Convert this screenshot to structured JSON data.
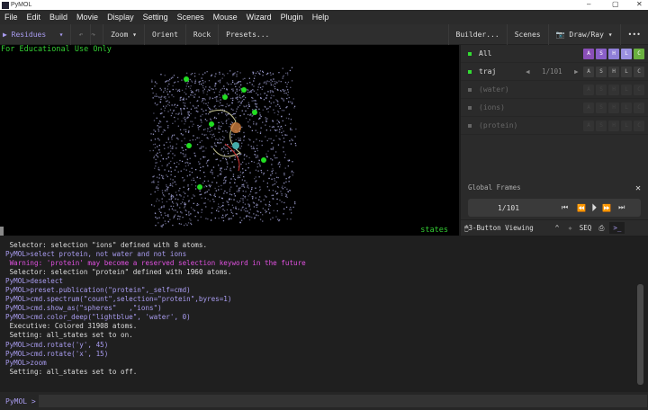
{
  "window": {
    "title": "PyMOL",
    "minimize": "–",
    "maximize": "▢",
    "close": "✕"
  },
  "menu": [
    "File",
    "Edit",
    "Build",
    "Movie",
    "Display",
    "Setting",
    "Scenes",
    "Mouse",
    "Wizard",
    "Plugin",
    "Help"
  ],
  "toolbar": {
    "mode": "Residues",
    "zoom": "Zoom",
    "orient": "Orient",
    "rock": "Rock",
    "presets": "Presets...",
    "builder": "Builder...",
    "scenes": "Scenes",
    "drawray": "Draw/Ray",
    "more": "•••"
  },
  "viewport": {
    "watermark": "For Educational Use Only",
    "states": "states"
  },
  "objects": [
    {
      "name": "All",
      "buttons": [
        "A",
        "S",
        "H",
        "L",
        "C"
      ],
      "enabled": true
    },
    {
      "name": "traj",
      "frame": "1/101",
      "buttons": [
        "A",
        "S",
        "H",
        "L",
        "C"
      ],
      "enabled": true
    },
    {
      "name": "(water)",
      "buttons": [
        "A",
        "S",
        "H",
        "L",
        "C"
      ],
      "enabled": false
    },
    {
      "name": "(ions)",
      "buttons": [
        "A",
        "S",
        "H",
        "L",
        "C"
      ],
      "enabled": false
    },
    {
      "name": "(protein)",
      "buttons": [
        "A",
        "S",
        "H",
        "L",
        "C"
      ],
      "enabled": false
    }
  ],
  "global_frames": {
    "label": "Global Frames",
    "frame": "1/101"
  },
  "statusbar": {
    "mouse_mode": "3-Button Viewing",
    "seq": "SEQ"
  },
  "console": [
    {
      "t": " Selector: selection \"ions\" defined with 8 atoms.",
      "c": "#ddd"
    },
    {
      "t": "PyMOL>select protein, not water and not ions",
      "c": "#a99cf0"
    },
    {
      "t": " Warning: 'protein' may become a reserved selection keyword in the future",
      "c": "#e050e0"
    },
    {
      "t": " Selector: selection \"protein\" defined with 1960 atoms.",
      "c": "#ddd"
    },
    {
      "t": "PyMOL>deselect",
      "c": "#a99cf0"
    },
    {
      "t": "PyMOL>preset.publication(\"protein\",_self=cmd)",
      "c": "#a99cf0"
    },
    {
      "t": "PyMOL>cmd.spectrum(\"count\",selection=\"protein\",byres=1)",
      "c": "#a99cf0"
    },
    {
      "t": "PyMOL>cmd.show_as(\"spheres\"   ,\"ions\")",
      "c": "#a99cf0"
    },
    {
      "t": "PyMOL>cmd.color_deep(\"lightblue\", 'water', 0)",
      "c": "#a99cf0"
    },
    {
      "t": " Executive: Colored 31908 atoms.",
      "c": "#ddd"
    },
    {
      "t": " Setting: all_states set to on.",
      "c": "#ddd"
    },
    {
      "t": "PyMOL>cmd.rotate('y', 45)",
      "c": "#a99cf0"
    },
    {
      "t": "PyMOL>cmd.rotate('x', 15)",
      "c": "#a99cf0"
    },
    {
      "t": "PyMOL>zoom",
      "c": "#a99cf0"
    },
    {
      "t": " Setting: all_states set to off.",
      "c": "#ddd"
    }
  ],
  "command": {
    "prompt": "PyMOL >",
    "value": ""
  }
}
